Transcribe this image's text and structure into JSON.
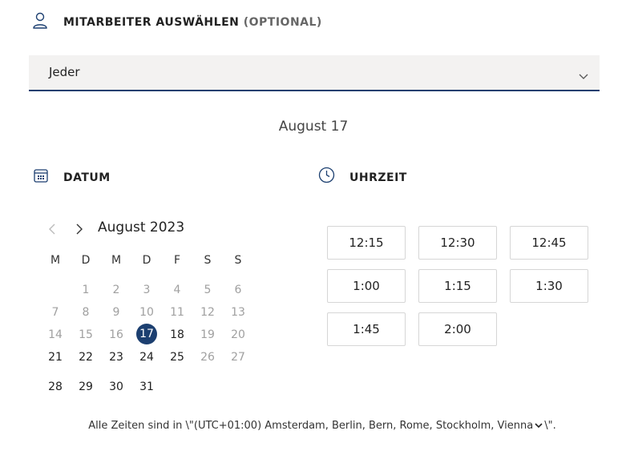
{
  "staff": {
    "label": "MITARBEITER AUSWÄHLEN",
    "optional": "(OPTIONAL)",
    "selected": "Jeder"
  },
  "selected_date_heading": "August 17",
  "date_section": {
    "label": "DATUM"
  },
  "time_section": {
    "label": "UHRZEIT"
  },
  "calendar": {
    "month_title": "August 2023",
    "weekdays": [
      "M",
      "D",
      "M",
      "D",
      "F",
      "S",
      "S"
    ],
    "weeks": [
      [
        null,
        1,
        2,
        3,
        4,
        5,
        6
      ],
      [
        7,
        8,
        9,
        10,
        11,
        12,
        13
      ],
      [
        14,
        15,
        16,
        17,
        18,
        19,
        20
      ],
      [
        21,
        22,
        23,
        24,
        25,
        26,
        27
      ],
      [
        28,
        29,
        30,
        31,
        null,
        null,
        null
      ]
    ],
    "selected_day": 17,
    "enabled_days": [
      17,
      18,
      21,
      22,
      23,
      24,
      25,
      28,
      29,
      30,
      31
    ]
  },
  "time_slots": [
    "12:15",
    "12:30",
    "12:45",
    "1:00",
    "1:15",
    "1:30",
    "1:45",
    "2:00"
  ],
  "timezone": {
    "prefix": "Alle Zeiten sind in \\\"",
    "value": "(UTC+01:00) Amsterdam, Berlin, Bern, Rome, Stockholm, Vienna",
    "suffix": "\\\"."
  },
  "colors": {
    "accent": "#1c3f70",
    "select_bg": "#f3f2f1"
  },
  "icons": [
    "person-icon",
    "chevron-down-icon",
    "calendar-icon",
    "clock-icon",
    "chevron-left-icon",
    "chevron-right-icon"
  ]
}
